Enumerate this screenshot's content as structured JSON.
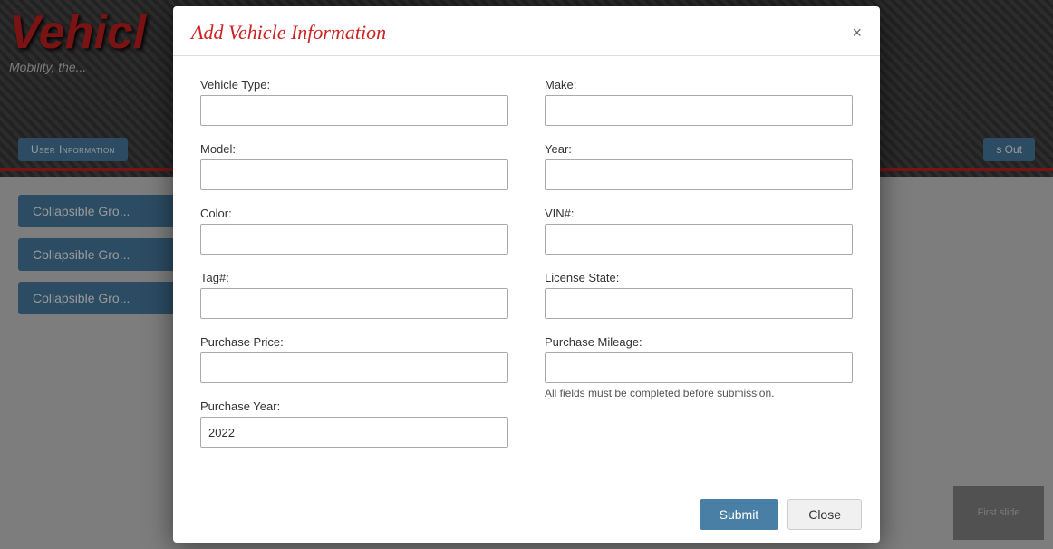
{
  "header": {
    "logo_text": "Vehicl",
    "logo_subtext": "Mobility, the...",
    "nav_user_info": "User Information",
    "nav_sign_out": "s Out"
  },
  "collapsible": {
    "btn1": "Collapsible Gro...",
    "btn2": "Collapsible Gro...",
    "btn3": "Collapsible Gro..."
  },
  "first_slide": "First slide",
  "modal": {
    "title": "Add Vehicle Information",
    "close_btn": "×",
    "fields": {
      "vehicle_type_label": "Vehicle Type:",
      "make_label": "Make:",
      "model_label": "Model:",
      "year_label": "Year:",
      "color_label": "Color:",
      "vin_label": "VIN#:",
      "tag_label": "Tag#:",
      "license_state_label": "License State:",
      "purchase_price_label": "Purchase Price:",
      "purchase_mileage_label": "Purchase Mileage:",
      "purchase_year_label": "Purchase Year:",
      "purchase_year_value": "2022"
    },
    "validation_message": "All fields must be completed before submission.",
    "submit_label": "Submit",
    "close_label": "Close"
  }
}
